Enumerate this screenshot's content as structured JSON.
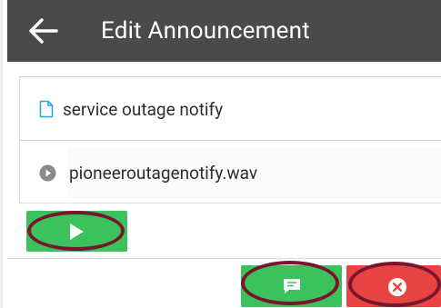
{
  "header": {
    "title": "Edit Announcement",
    "back_icon": "arrow-left-icon",
    "background": "#4a4a4a"
  },
  "announcement": {
    "name": "service outage notify",
    "name_icon": "document-icon",
    "audio_file": "pioneeroutagenotify.wav",
    "audio_icon": "play-circle-icon"
  },
  "actions": {
    "play_icon": "play-icon",
    "message_icon": "chat-bubble-icon",
    "cancel_icon": "cancel-circle-icon"
  },
  "colors": {
    "accent_green": "#3cc25c",
    "cancel_red": "#e84444",
    "document_blue": "#2fa6e6",
    "highlight_ring": "#7a1530"
  }
}
